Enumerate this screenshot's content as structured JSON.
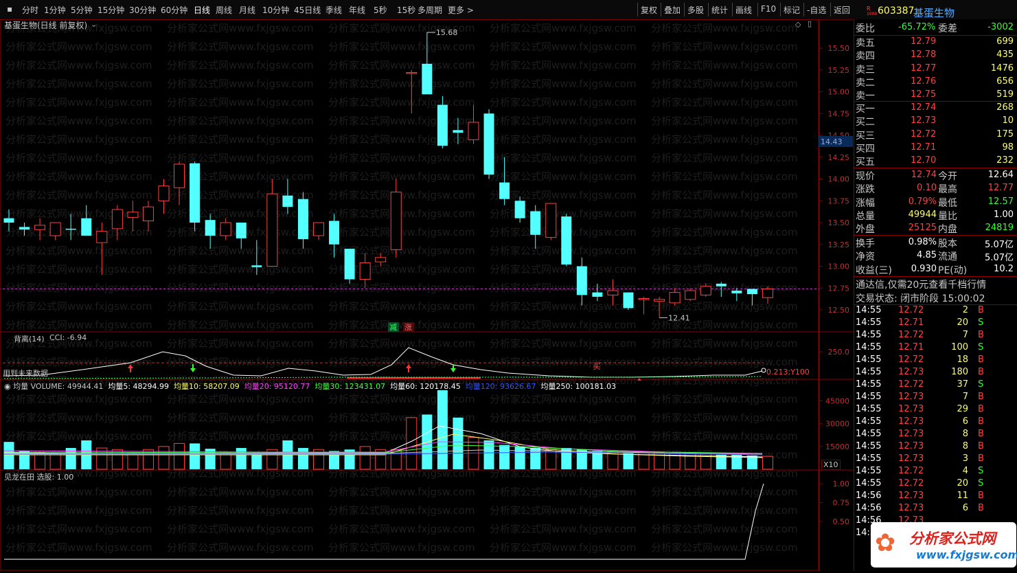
{
  "toolbar": {
    "left_tabs": [
      "分时",
      "1分钟",
      "5分钟",
      "15分钟",
      "30分钟",
      "60分钟",
      "日线",
      "周线",
      "月线",
      "10分钟",
      "45日线",
      "季线",
      "年线",
      "5秒",
      "15秒",
      "多周期",
      "更多 >"
    ],
    "active_tab": "日线",
    "right_buttons": [
      "复权",
      "叠加",
      "多股",
      "统计",
      "画线",
      "F10",
      "标记",
      "-自选",
      "返回"
    ]
  },
  "stock": {
    "code": "603387",
    "name": "基蛋生物",
    "badge_r": "R",
    "badge_sub": "1000",
    "chart_title": "基蛋生物(日线 前复权)"
  },
  "main_chart": {
    "price_ticks": [
      "15.50",
      "15.25",
      "15.00",
      "14.75",
      "14.50",
      "14.25",
      "14.00",
      "13.75",
      "13.50",
      "13.25",
      "13.00",
      "12.75",
      "12.50"
    ],
    "current_price_tag": "14.43",
    "high_label": "15.68",
    "low_label": "12.41",
    "marker_jian": "减",
    "marker_zhang": "涨",
    "watermark": "分析家公式网www.fxjgsw.com"
  },
  "cci_panel": {
    "title": "背离(14)",
    "value_label": "CCI: -6.94",
    "note": "用到未来数据",
    "tick": "250.0",
    "marker_buy": "买",
    "right_label": "0.213;Y100"
  },
  "volume_panel": {
    "title": "均量",
    "items": [
      {
        "label": "VOLUME: 49944.41",
        "color": "#c8c8c8"
      },
      {
        "label": "均量5: 48294.99",
        "color": "#ffffff"
      },
      {
        "label": "均量10: 58207.09",
        "color": "#ffff66"
      },
      {
        "label": "均量20: 95120.77",
        "color": "#ff44ff"
      },
      {
        "label": "均量30: 123431.07",
        "color": "#44ff44"
      },
      {
        "label": "均量60: 120178.45",
        "color": "#ffffff"
      },
      {
        "label": "均量120: 93626.67",
        "color": "#3355ff"
      },
      {
        "label": "均量250: 100181.03",
        "color": "#ffffff"
      }
    ],
    "ticks": [
      "45000",
      "30000",
      "15000"
    ],
    "multiplier": "X10"
  },
  "signal_panel": {
    "title": "见龙在田",
    "value_label": "选股: 1.00",
    "ticks": [
      "1.00",
      "0.75",
      "0.50"
    ]
  },
  "committee": {
    "label": "委比",
    "ratio": "-65.72%",
    "diff_label": "委差",
    "diff": "-3002"
  },
  "asks": [
    {
      "label": "卖五",
      "price": "12.79",
      "vol": "699"
    },
    {
      "label": "卖四",
      "price": "12.78",
      "vol": "435"
    },
    {
      "label": "卖三",
      "price": "12.77",
      "vol": "1476"
    },
    {
      "label": "卖二",
      "price": "12.76",
      "vol": "656"
    },
    {
      "label": "卖一",
      "price": "12.75",
      "vol": "519"
    }
  ],
  "bids": [
    {
      "label": "买一",
      "price": "12.74",
      "vol": "268"
    },
    {
      "label": "买二",
      "price": "12.73",
      "vol": "10"
    },
    {
      "label": "买三",
      "price": "12.72",
      "vol": "175"
    },
    {
      "label": "买四",
      "price": "12.71",
      "vol": "98"
    },
    {
      "label": "买五",
      "price": "12.70",
      "vol": "232"
    }
  ],
  "quote": [
    {
      "l1": "现价",
      "v1": "12.74",
      "l2": "今开",
      "v2": "12.64",
      "c1": "#ff4040",
      "c2": "#ffffff"
    },
    {
      "l1": "涨跌",
      "v1": "0.10",
      "l2": "最高",
      "v2": "12.77",
      "c1": "#ff4040",
      "c2": "#ff4040"
    },
    {
      "l1": "涨幅",
      "v1": "0.79%",
      "l2": "最低",
      "v2": "12.57",
      "c1": "#ff4040",
      "c2": "#33ff33"
    },
    {
      "l1": "总量",
      "v1": "49944",
      "l2": "量比",
      "v2": "1.00",
      "c1": "#ffff66",
      "c2": "#ffffff"
    },
    {
      "l1": "外盘",
      "v1": "25125",
      "l2": "内盘",
      "v2": "24819",
      "c1": "#ff4040",
      "c2": "#33ff33"
    }
  ],
  "fundamentals": [
    {
      "l1": "换手",
      "v1": "0.98%",
      "l2": "股本",
      "v2": "5.07亿"
    },
    {
      "l1": "净资",
      "v1": "4.85",
      "l2": "流通",
      "v2": "5.07亿"
    },
    {
      "l1": "收益(三)",
      "v1": "0.930",
      "l2": "PE(动)",
      "v2": "10.2"
    }
  ],
  "promo": "通达信,仅需20元查看千档行情",
  "trade_status": "交易状态: 闭市阶段 15:00:02",
  "ticks": [
    {
      "t": "14:55",
      "p": "12.72",
      "v": "2",
      "d": "B"
    },
    {
      "t": "14:55",
      "p": "12.71",
      "v": "20",
      "d": "S"
    },
    {
      "t": "14:55",
      "p": "12.72",
      "v": "7",
      "d": "B"
    },
    {
      "t": "14:55",
      "p": "12.71",
      "v": "100",
      "d": "S"
    },
    {
      "t": "14:55",
      "p": "12.72",
      "v": "18",
      "d": "B"
    },
    {
      "t": "14:55",
      "p": "12.73",
      "v": "180",
      "d": "B"
    },
    {
      "t": "14:55",
      "p": "12.72",
      "v": "37",
      "d": "S"
    },
    {
      "t": "14:55",
      "p": "12.73",
      "v": "7",
      "d": "B"
    },
    {
      "t": "14:55",
      "p": "12.73",
      "v": "29",
      "d": "B"
    },
    {
      "t": "14:55",
      "p": "12.73",
      "v": "6",
      "d": "B"
    },
    {
      "t": "14:55",
      "p": "12.73",
      "v": "8",
      "d": "B"
    },
    {
      "t": "14:55",
      "p": "12.73",
      "v": "8",
      "d": "B"
    },
    {
      "t": "14:55",
      "p": "12.73",
      "v": "3",
      "d": "B"
    },
    {
      "t": "14:55",
      "p": "12.72",
      "v": "4",
      "d": "S"
    },
    {
      "t": "14:55",
      "p": "12.72",
      "v": "20",
      "d": "S"
    },
    {
      "t": "14:56",
      "p": "12.73",
      "v": "11",
      "d": "B"
    },
    {
      "t": "14:56",
      "p": "12.73",
      "v": "6",
      "d": "B"
    },
    {
      "t": "14:56",
      "p": "12.73",
      "v": "",
      "d": ""
    },
    {
      "t": "14:56",
      "p": "",
      "v": "",
      "d": ""
    }
  ],
  "logo": {
    "text": "分析家公式网",
    "url": "www.fxjgsw.com"
  },
  "colors": {
    "up": "#ff4040",
    "down": "#54ffff",
    "grid": "#8a0000",
    "bg": "#000000"
  },
  "chart_data": {
    "type": "candlestick",
    "candles": [
      {
        "o": 13.55,
        "h": 13.65,
        "l": 13.4,
        "c": 13.5
      },
      {
        "o": 13.45,
        "h": 13.5,
        "l": 13.35,
        "c": 13.42
      },
      {
        "o": 13.42,
        "h": 13.55,
        "l": 13.3,
        "c": 13.47
      },
      {
        "o": 13.35,
        "h": 13.5,
        "l": 13.3,
        "c": 13.5
      },
      {
        "o": 13.43,
        "h": 13.6,
        "l": 13.3,
        "c": 13.42
      },
      {
        "o": 13.55,
        "h": 13.7,
        "l": 13.4,
        "c": 13.35
      },
      {
        "o": 13.27,
        "h": 13.5,
        "l": 12.9,
        "c": 13.4
      },
      {
        "o": 13.43,
        "h": 13.7,
        "l": 13.3,
        "c": 13.65
      },
      {
        "o": 13.56,
        "h": 13.75,
        "l": 13.4,
        "c": 13.62
      },
      {
        "o": 13.52,
        "h": 13.75,
        "l": 13.4,
        "c": 13.68
      },
      {
        "o": 13.75,
        "h": 14.0,
        "l": 13.6,
        "c": 13.92
      },
      {
        "o": 13.9,
        "h": 14.2,
        "l": 13.7,
        "c": 14.17
      },
      {
        "o": 14.18,
        "h": 14.2,
        "l": 13.4,
        "c": 13.5
      },
      {
        "o": 13.53,
        "h": 13.6,
        "l": 13.2,
        "c": 13.35
      },
      {
        "o": 13.35,
        "h": 13.55,
        "l": 13.3,
        "c": 13.5
      },
      {
        "o": 13.5,
        "h": 13.5,
        "l": 13.2,
        "c": 13.32
      },
      {
        "o": 13.01,
        "h": 13.3,
        "l": 12.9,
        "c": 12.99
      },
      {
        "o": 13.0,
        "h": 14.0,
        "l": 13.0,
        "c": 13.83
      },
      {
        "o": 13.81,
        "h": 14.0,
        "l": 13.6,
        "c": 13.68
      },
      {
        "o": 13.77,
        "h": 13.85,
        "l": 13.2,
        "c": 13.31
      },
      {
        "o": 13.35,
        "h": 13.45,
        "l": 13.3,
        "c": 13.5
      },
      {
        "o": 13.52,
        "h": 13.6,
        "l": 13.1,
        "c": 13.25
      },
      {
        "o": 13.2,
        "h": 13.2,
        "l": 12.8,
        "c": 12.85
      },
      {
        "o": 12.85,
        "h": 13.15,
        "l": 12.75,
        "c": 13.04
      },
      {
        "o": 13.05,
        "h": 13.15,
        "l": 13.0,
        "c": 13.1
      },
      {
        "o": 13.19,
        "h": 14.0,
        "l": 13.1,
        "c": 13.85
      },
      {
        "o": 15.22,
        "h": 15.25,
        "l": 14.75,
        "c": 15.22
      },
      {
        "o": 15.32,
        "h": 15.68,
        "l": 14.98,
        "c": 14.97
      },
      {
        "o": 14.85,
        "h": 14.95,
        "l": 14.35,
        "c": 14.38
      },
      {
        "o": 14.56,
        "h": 14.7,
        "l": 14.4,
        "c": 14.53
      },
      {
        "o": 14.45,
        "h": 14.85,
        "l": 14.4,
        "c": 14.65
      },
      {
        "o": 14.75,
        "h": 14.8,
        "l": 14.0,
        "c": 14.05
      },
      {
        "o": 13.96,
        "h": 14.25,
        "l": 13.7,
        "c": 13.77
      },
      {
        "o": 13.75,
        "h": 13.8,
        "l": 13.5,
        "c": 13.55
      },
      {
        "o": 13.63,
        "h": 13.7,
        "l": 13.2,
        "c": 13.36
      },
      {
        "o": 13.33,
        "h": 13.7,
        "l": 13.3,
        "c": 13.72
      },
      {
        "o": 13.57,
        "h": 13.6,
        "l": 13.0,
        "c": 13.02
      },
      {
        "o": 13.0,
        "h": 13.1,
        "l": 12.55,
        "c": 12.67
      },
      {
        "o": 12.7,
        "h": 12.8,
        "l": 12.6,
        "c": 12.65
      },
      {
        "o": 12.67,
        "h": 12.85,
        "l": 12.55,
        "c": 12.72
      },
      {
        "o": 12.7,
        "h": 12.7,
        "l": 12.5,
        "c": 12.52
      },
      {
        "o": 12.62,
        "h": 12.65,
        "l": 12.45,
        "c": 12.63
      },
      {
        "o": 12.6,
        "h": 12.65,
        "l": 12.41,
        "c": 12.62
      },
      {
        "o": 12.58,
        "h": 12.75,
        "l": 12.55,
        "c": 12.7
      },
      {
        "o": 12.62,
        "h": 12.75,
        "l": 12.6,
        "c": 12.72
      },
      {
        "o": 12.67,
        "h": 12.8,
        "l": 12.65,
        "c": 12.77
      },
      {
        "o": 12.8,
        "h": 12.82,
        "l": 12.65,
        "c": 12.77
      },
      {
        "o": 12.72,
        "h": 12.75,
        "l": 12.6,
        "c": 12.69
      },
      {
        "o": 12.74,
        "h": 12.74,
        "l": 12.55,
        "c": 12.68
      },
      {
        "o": 12.64,
        "h": 12.77,
        "l": 12.57,
        "c": 12.74
      }
    ],
    "volume": [
      18000,
      12000,
      11000,
      9500,
      14000,
      19000,
      14000,
      13000,
      10500,
      13000,
      15000,
      17000,
      17000,
      13500,
      11000,
      14000,
      11000,
      13000,
      19000,
      14000,
      13000,
      12000,
      13000,
      15000,
      13000,
      13000,
      34000,
      36000,
      52000,
      34000,
      21000,
      19000,
      16000,
      15000,
      14000,
      13000,
      14000,
      13000,
      12000,
      11500,
      11000,
      11000,
      11000,
      10500,
      10500,
      10000,
      9500,
      9500,
      9000,
      8500
    ],
    "price_range": [
      12.35,
      15.72
    ],
    "volume_range": [
      0,
      52000
    ]
  }
}
